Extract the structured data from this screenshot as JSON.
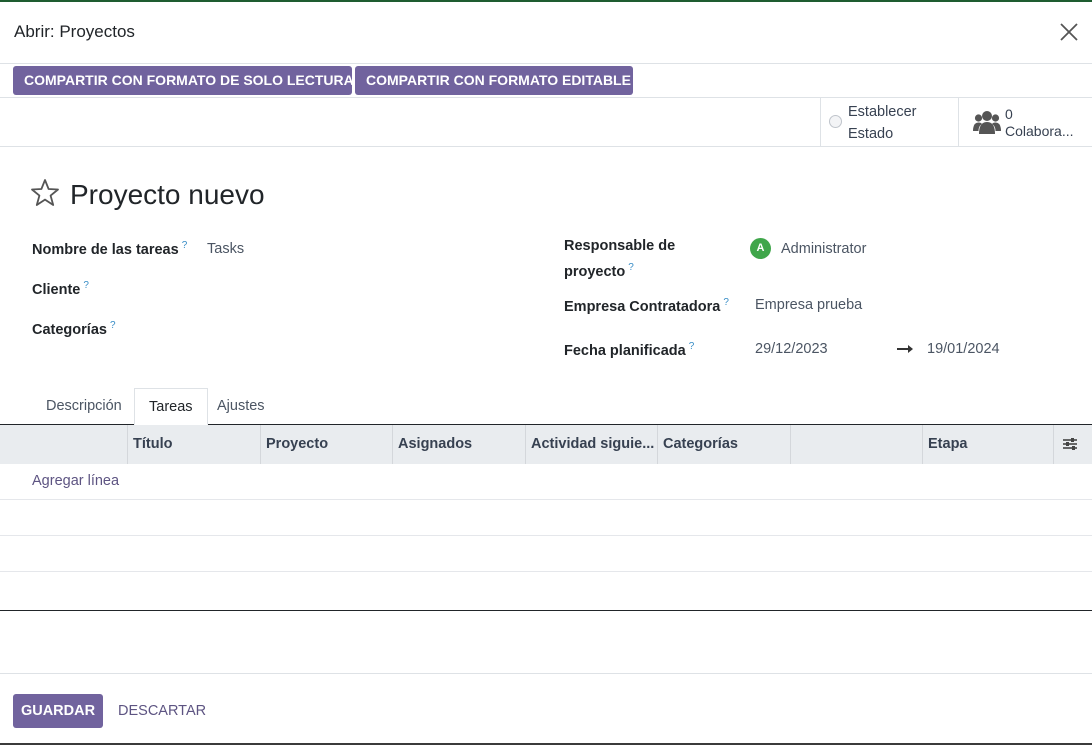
{
  "dialog": {
    "title": "Abrir: Proyectos"
  },
  "share": {
    "readonly_label": "COMPARTIR CON FORMATO DE SOLO LECTURA",
    "editable_label": "COMPARTIR CON FORMATO EDITABLE"
  },
  "statusbar": {
    "status_line1": "Establecer",
    "status_line2": "Estado",
    "collaborators_count": "0",
    "collaborators_label": "Colabora..."
  },
  "record": {
    "title": "Proyecto nuevo",
    "help_mark": "?",
    "fields": {
      "task_name": {
        "label": "Nombre de las tareas",
        "value": "Tasks"
      },
      "customer": {
        "label": "Cliente",
        "value": ""
      },
      "tags": {
        "label": "Categorías",
        "value": ""
      },
      "manager": {
        "label_line1": "Responsable de",
        "label_line2": "proyecto",
        "value": "Administrator",
        "avatar": "A"
      },
      "company": {
        "label": "Empresa Contratadora",
        "value": "Empresa prueba"
      },
      "planned_date": {
        "label": "Fecha planificada",
        "start": "29/12/2023",
        "end": "19/01/2024"
      }
    }
  },
  "tabs": [
    {
      "label": "Descripción"
    },
    {
      "label": "Tareas"
    },
    {
      "label": "Ajustes"
    }
  ],
  "list": {
    "columns": [
      "Título",
      "Proyecto",
      "Asignados",
      "Actividad siguie...",
      "Categorías",
      "",
      "Etapa"
    ],
    "add_line": "Agregar línea"
  },
  "footer": {
    "save_label": "GUARDAR",
    "discard_label": "DESCARTAR"
  },
  "colors": {
    "primary": "#71639e",
    "link": "#5d5482",
    "avatar": "#3fa64a",
    "help": "#3a8ec7"
  },
  "icons": [
    "close-icon",
    "star-icon",
    "users-icon",
    "arrow-right-icon",
    "optional-columns-icon"
  ]
}
